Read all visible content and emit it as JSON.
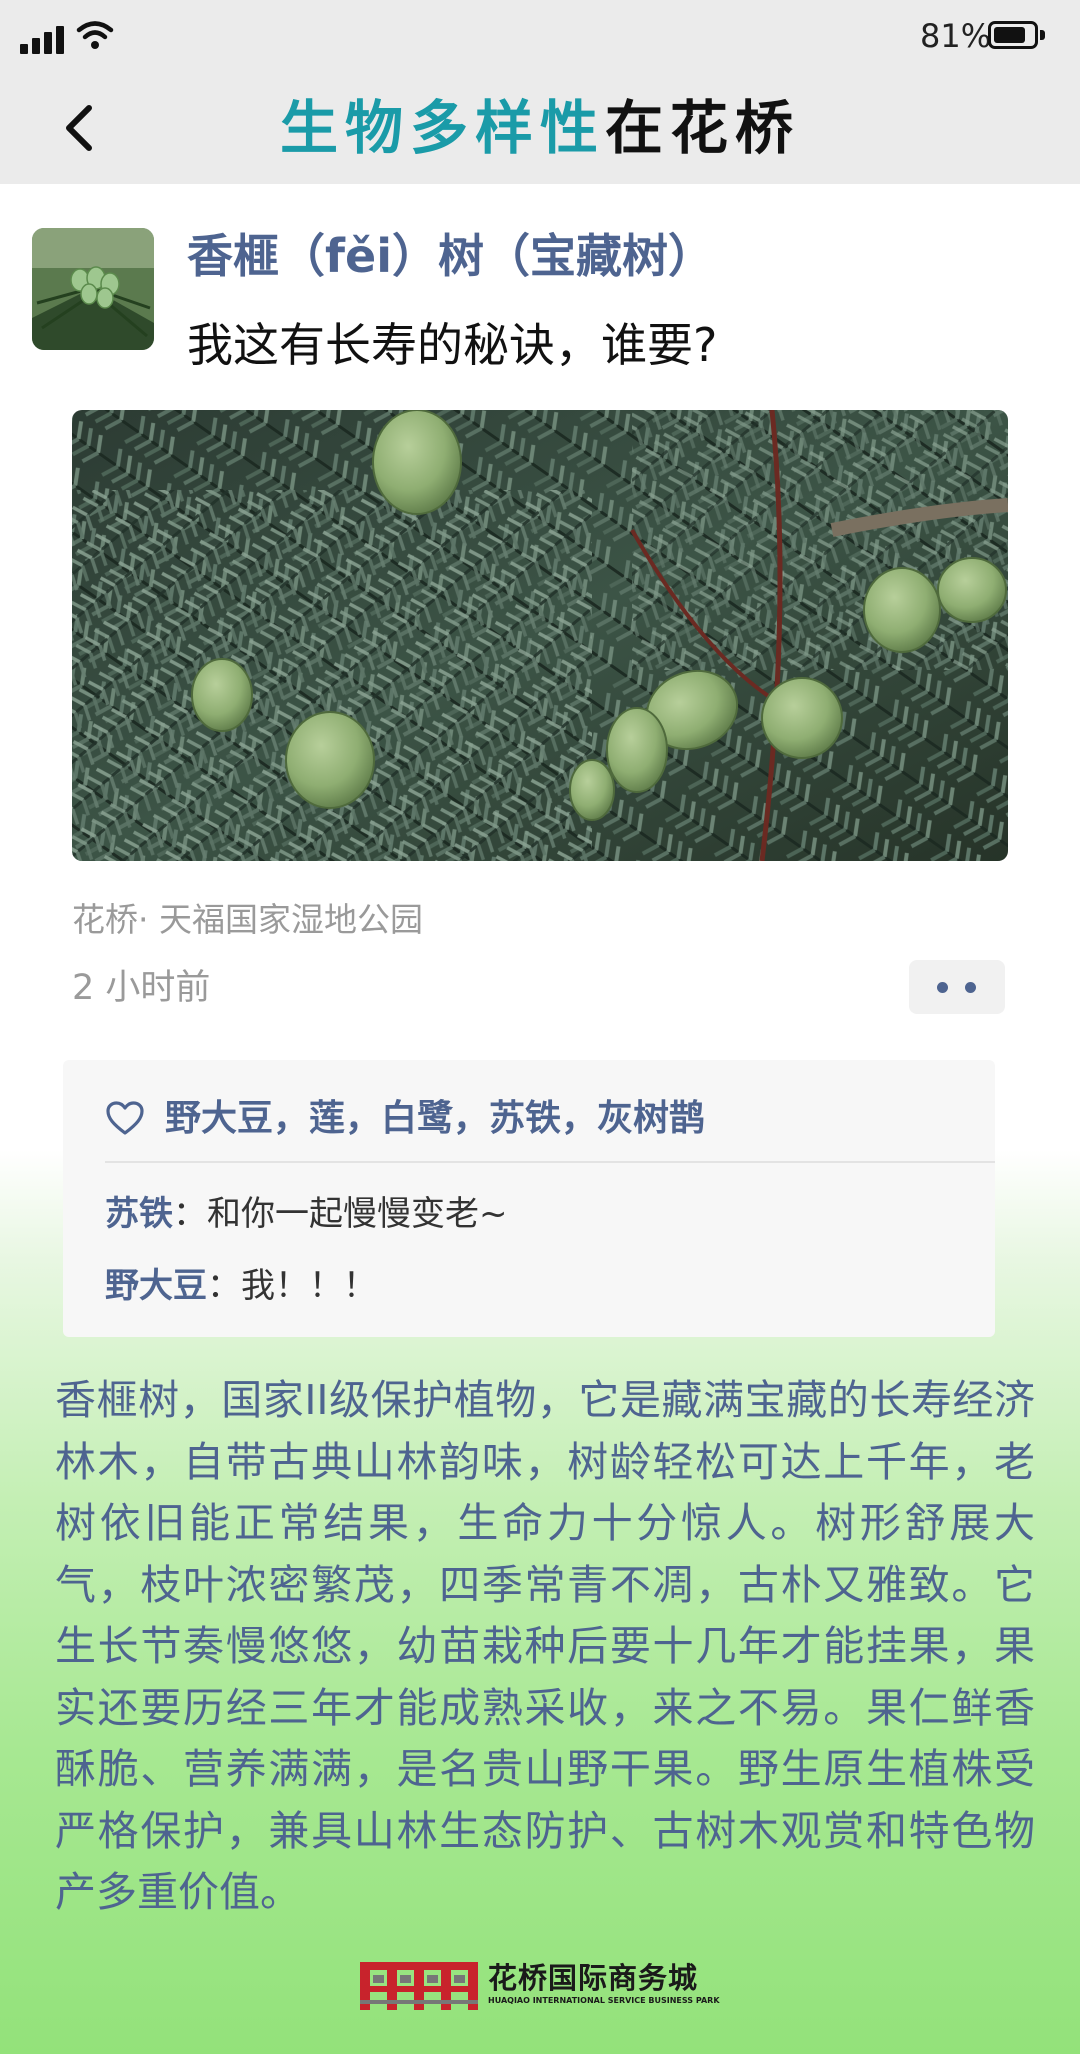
{
  "status_bar": {
    "battery_percent_label": "81%",
    "battery_level": 0.81
  },
  "header": {
    "title_accent": "生物多样性",
    "title_rest": "在花桥",
    "accent_color": "#1a9ba8"
  },
  "post": {
    "author": "香榧（fěi）树（宝藏树）",
    "text": "我这有长寿的秘诀，谁要?",
    "location": "花桥· 天福国家湿地公园",
    "time_ago": "2 小时前",
    "likes": "野大豆，莲，白鹭，苏铁，灰树鹊",
    "comments": [
      {
        "author": "苏铁",
        "separator": "：",
        "text": "和你一起慢慢变老~"
      },
      {
        "author": "野大豆",
        "separator": "：",
        "text": "我！！！"
      }
    ]
  },
  "description": "香榧树，国家II级保护植物，它是藏满宝藏的长寿经济林木，自带古典山林韵味，树龄轻松可达上千年，老树依旧能正常结果，生命力十分惊人。树形舒展大气，枝叶浓密繁茂，四季常青不凋，古朴又雅致。它生长节奏慢悠悠，幼苗栽种后要十几年才能挂果，果实还要历经三年才能成熟采收，来之不易。果仁鲜香酥脆、营养满满，是名贵山野干果。野生原生植株受严格保护，兼具山林生态防护、古树木观赏和特色物产多重价值。",
  "footer": {
    "name": "花桥国际商务城",
    "name_en": "HUAQIAO INTERNATIONAL SERVICE BUSINESS PARK"
  },
  "colors": {
    "name_blue": "#4e6490",
    "logo_red": "#c8232c"
  }
}
